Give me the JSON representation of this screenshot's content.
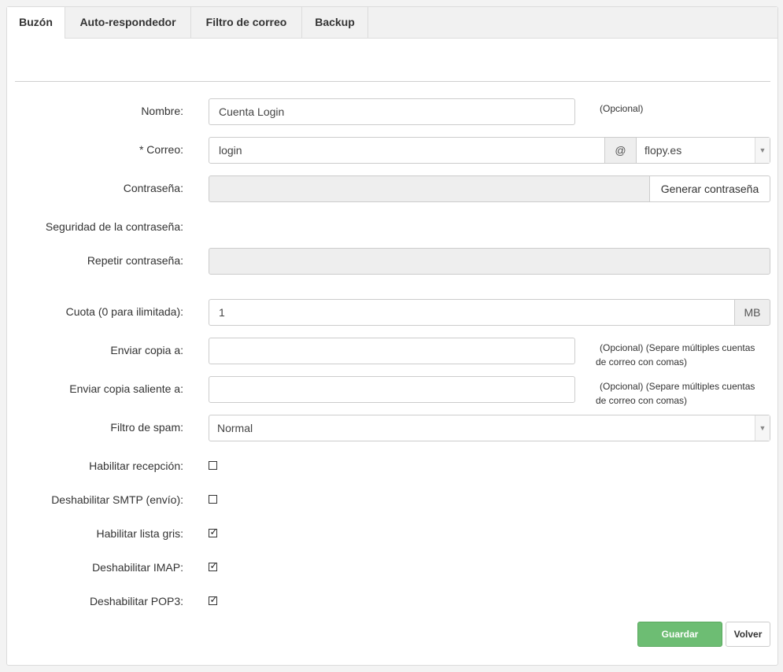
{
  "tabs": [
    {
      "label": "Buzón",
      "active": true
    },
    {
      "label": "Auto-respondedor",
      "active": false
    },
    {
      "label": "Filtro de correo",
      "active": false
    },
    {
      "label": "Backup",
      "active": false
    }
  ],
  "form": {
    "nombre": {
      "label": "Nombre:",
      "value": "Cuenta Login",
      "hint": "(Opcional)"
    },
    "correo": {
      "label": "* Correo:",
      "value": "login",
      "at": "@",
      "domain": "flopy.es"
    },
    "contrasena": {
      "label": "Contraseña:",
      "value": "",
      "generate_label": "Generar contraseña"
    },
    "seguridad": {
      "label": "Seguridad de la contraseña:"
    },
    "repetir": {
      "label": "Repetir contraseña:",
      "value": ""
    },
    "cuota": {
      "label": "Cuota (0 para ilimitada):",
      "value": "1",
      "unit": "MB"
    },
    "copia": {
      "label": "Enviar copia a:",
      "value": "",
      "hint_line1": "(Opcional) (Separe múltiples cuentas",
      "hint_line2": "de correo con comas)"
    },
    "copia_saliente": {
      "label": "Enviar copia saliente a:",
      "value": "",
      "hint_line1": "(Opcional) (Separe múltiples cuentas",
      "hint_line2": "de correo con comas)"
    },
    "spam": {
      "label": "Filtro de spam:",
      "value": "Normal"
    },
    "recepcion": {
      "label": "Habilitar recepción:",
      "checked": false
    },
    "smtp": {
      "label": "Deshabilitar SMTP (envío):",
      "checked": false
    },
    "lista_gris": {
      "label": "Habilitar lista gris:",
      "checked": true
    },
    "imap": {
      "label": "Deshabilitar IMAP:",
      "checked": true
    },
    "pop3": {
      "label": "Deshabilitar POP3:",
      "checked": true
    }
  },
  "actions": {
    "save_label": "Guardar",
    "back_label": "Volver"
  },
  "colors": {
    "save": "#6dbd73",
    "tab_bg": "#f1f1f1"
  }
}
